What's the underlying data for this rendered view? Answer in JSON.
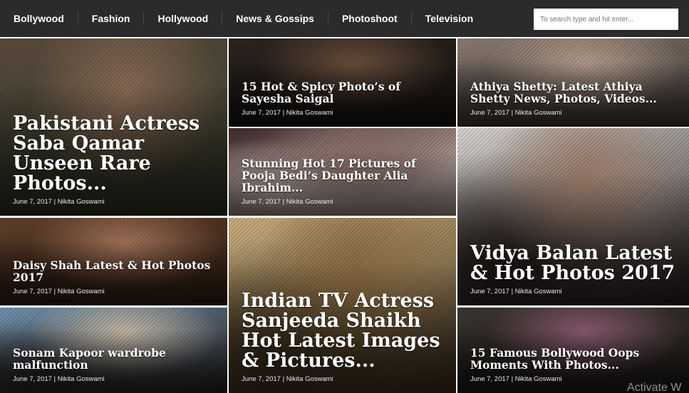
{
  "nav": {
    "items": [
      "Bollywood",
      "Fashion",
      "Hollywood",
      "News & Gossips",
      "Photoshoot",
      "Television"
    ],
    "search_placeholder": "To search type and hit enter..."
  },
  "posts": [
    {
      "title": "Pakistani Actress Saba Qamar Unseen Rare Photos...",
      "date": "June 7, 2017",
      "author": "Nikita Goswami",
      "colors": [
        "#5a4a3e",
        "#8a6a55",
        "#3a3f2c"
      ]
    },
    {
      "title": "15 Hot & Spicy Photo’s of Sayesha Saigal",
      "date": "June 7, 2017",
      "author": "Nikita Goswami",
      "colors": [
        "#2b2420",
        "#6b4f3c",
        "#1d1814"
      ]
    },
    {
      "title": "Athiya Shetty: Latest Athiya Shetty News, Photos, Videos...",
      "date": "June 7, 2017",
      "author": "Nikita Goswami",
      "colors": [
        "#8a7a70",
        "#b39c8c",
        "#4d4640"
      ]
    },
    {
      "title": "Stunning Hot 17 Pictures of Pooja Bedi’s Daughter Alia Ibrahim...",
      "date": "June 7, 2017",
      "author": "Nikita Goswami",
      "colors": [
        "#3d2a2a",
        "#8d6f6a",
        "#e0ccc2"
      ]
    },
    {
      "title": "Vidya Balan Latest & Hot Photos 2017",
      "date": "June 7, 2017",
      "author": "Nikita Goswami",
      "colors": [
        "#d7d3cf",
        "#9a7a68",
        "#2c2320"
      ]
    },
    {
      "title": "Daisy Shah Latest & Hot Photos 2017",
      "date": "June 7, 2017",
      "author": "Nikita Goswami",
      "colors": [
        "#5e3f2a",
        "#a3735a",
        "#3a2418"
      ]
    },
    {
      "title": "Indian TV Actress Sanjeeda Shaikh Hot Latest Images & Pictures...",
      "date": "June 7, 2017",
      "author": "Nikita Goswami",
      "colors": [
        "#c8ad7e",
        "#8a6a40",
        "#4a3a22"
      ]
    },
    {
      "title": "Sonam Kapoor wardrobe malfunction",
      "date": "June 7, 2017",
      "author": "Nikita Goswami",
      "colors": [
        "#6f90ad",
        "#c4b6a4",
        "#2e2a28"
      ]
    },
    {
      "title": "15 Famous Bollywood Oops Moments With Photos...",
      "date": "June 7, 2017",
      "author": "Nikita Goswami",
      "colors": [
        "#3a3530",
        "#8a5a70",
        "#231f1c"
      ]
    }
  ],
  "watermark": "Activate W"
}
